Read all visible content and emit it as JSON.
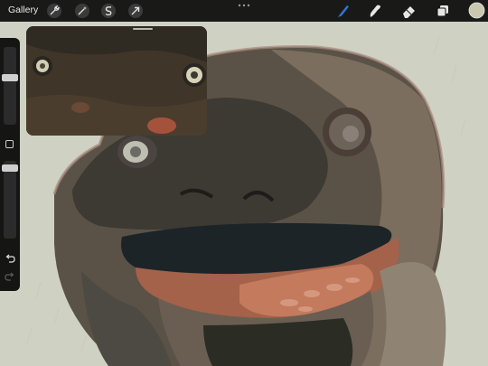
{
  "app": {
    "gallery_label": "Gallery"
  },
  "toolbar_left": {
    "icons": [
      "wrench-icon",
      "magic-wand-icon",
      "selection-s-icon",
      "transform-arrow-icon"
    ]
  },
  "toolbar_right": {
    "icons": [
      "brush-icon",
      "smudge-icon",
      "eraser-icon",
      "layers-icon",
      "color-swatch-icon"
    ],
    "active_tool": "brush",
    "accent_color": "#2e74d6",
    "current_color": "#c9c7b0"
  },
  "sidebar": {
    "brush_size_level": 0.25,
    "opacity_level": 0.25
  },
  "colors": {
    "toolbar_bg": "#141414",
    "canvas_bg": "#cfd1c3"
  }
}
